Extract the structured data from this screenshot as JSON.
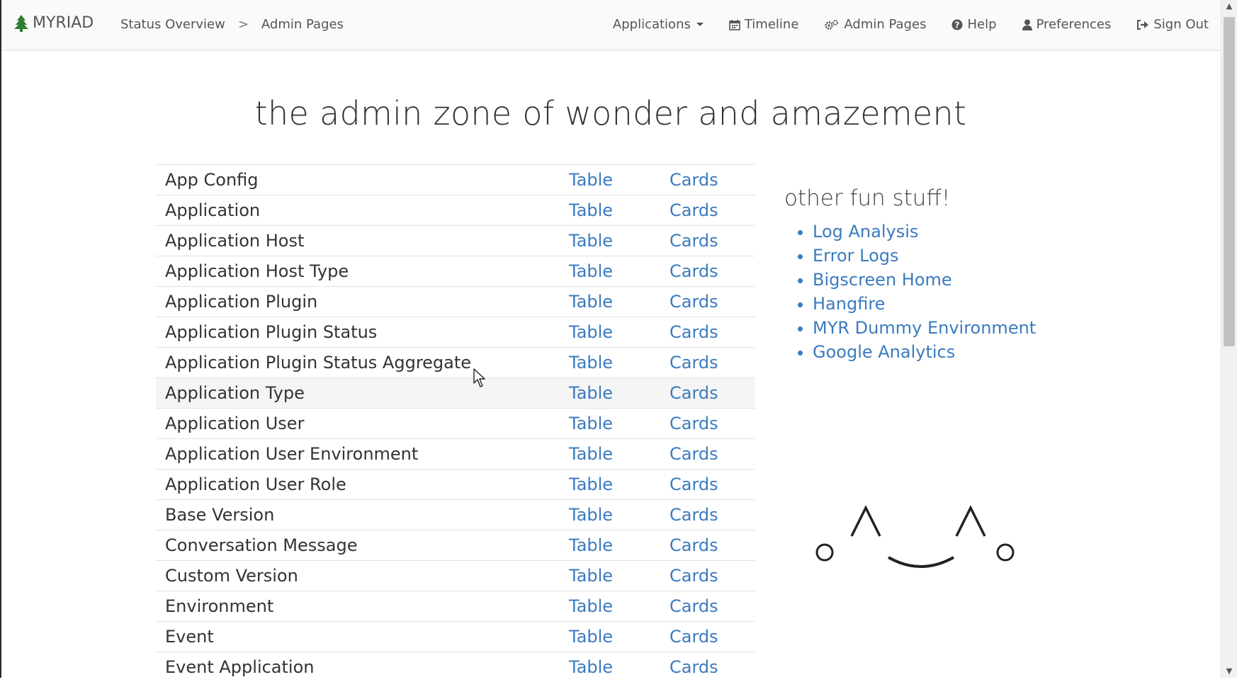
{
  "navbar": {
    "brand": "MYRIAD",
    "breadcrumb": [
      "Status Overview",
      "Admin Pages"
    ],
    "breadcrumb_separator": ">",
    "links": [
      {
        "label": "Applications",
        "icon": "caret-down-icon"
      },
      {
        "label": "Timeline",
        "icon": "calendar-icon"
      },
      {
        "label": "Admin Pages",
        "icon": "gears-icon"
      },
      {
        "label": "Help",
        "icon": "question-circle-icon"
      },
      {
        "label": "Preferences",
        "icon": "user-icon"
      },
      {
        "label": "Sign Out",
        "icon": "sign-out-icon"
      }
    ]
  },
  "page": {
    "title": "the admin zone of wonder and amazement"
  },
  "admin_table": {
    "table_label": "Table",
    "cards_label": "Cards",
    "rows": [
      "App Config",
      "Application",
      "Application Host",
      "Application Host Type",
      "Application Plugin",
      "Application Plugin Status",
      "Application Plugin Status Aggregate",
      "Application Type",
      "Application User",
      "Application User Environment",
      "Application User Role",
      "Base Version",
      "Conversation Message",
      "Custom Version",
      "Environment",
      "Event",
      "Event Application"
    ]
  },
  "sidebar": {
    "heading": "other fun stuff!",
    "links": [
      "Log Analysis",
      "Error Logs",
      "Bigscreen Home",
      "Hangfire",
      "MYR Dummy Environment",
      "Google Analytics"
    ]
  },
  "colors": {
    "link": "#3b7bbf",
    "brand_tree": "#2e7d32",
    "text": "#333333"
  }
}
